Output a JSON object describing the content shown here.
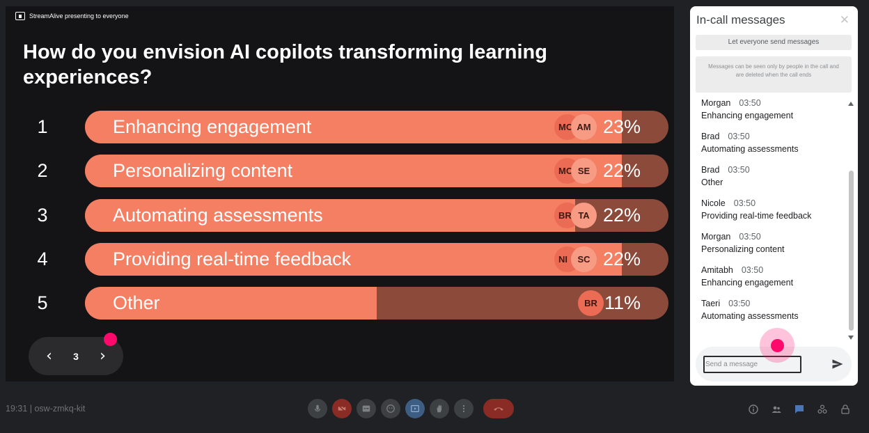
{
  "presentation": {
    "presenting_text": "StreamAlive presenting to everyone",
    "question": "How do you envision AI copilots transforming learning experiences?",
    "options": [
      {
        "number": "1",
        "label": "Enhancing engagement",
        "percent": "23%",
        "fill": 0.92,
        "avatars": [
          "MC",
          "AM"
        ]
      },
      {
        "number": "2",
        "label": "Personalizing content",
        "percent": "22%",
        "fill": 0.92,
        "avatars": [
          "MC",
          "SE"
        ]
      },
      {
        "number": "3",
        "label": "Automating assessments",
        "percent": "22%",
        "fill": 0.84,
        "avatars": [
          "BR",
          "TA"
        ]
      },
      {
        "number": "4",
        "label": "Providing real-time feedback",
        "percent": "22%",
        "fill": 0.92,
        "avatars": [
          "NI",
          "SC"
        ]
      },
      {
        "number": "5",
        "label": "Other",
        "percent": "11%",
        "fill": 0.5,
        "avatars": [
          "BR"
        ]
      }
    ],
    "pager": {
      "page": "3",
      "prev_icon": "chevron-left-icon",
      "next_icon": "chevron-right-icon"
    }
  },
  "panel": {
    "title": "In-call messages",
    "close_icon": "close-icon",
    "toggle_label": "Let everyone send messages",
    "info": "Messages can be seen only by people in the call and are deleted when the call ends",
    "messages": [
      {
        "sender": "Morgan",
        "time": "03:50",
        "text": "Enhancing engagement"
      },
      {
        "sender": "Brad",
        "time": "03:50",
        "text": "Automating assessments"
      },
      {
        "sender": "Brad",
        "time": "03:50",
        "text": "Other"
      },
      {
        "sender": "Nicole",
        "time": "03:50",
        "text": "Providing real-time feedback"
      },
      {
        "sender": "Morgan",
        "time": "03:50",
        "text": "Personalizing content"
      },
      {
        "sender": "Amitabh",
        "time": "03:50",
        "text": "Enhancing engagement"
      },
      {
        "sender": "Taeri",
        "time": "03:50",
        "text": "Automating assessments"
      }
    ],
    "compose_placeholder": "Send a message",
    "send_icon": "send-icon"
  },
  "bottom": {
    "meeting_info": "19:31 | osw-zmkq-kit",
    "controls": [
      "mic-icon",
      "camera-off-icon",
      "captions-icon",
      "emoji-icon",
      "present-icon",
      "raise-hand-icon",
      "more-options-icon",
      "end-call-icon"
    ],
    "right_icons": [
      "info-icon",
      "people-icon",
      "chat-icon",
      "activities-icon",
      "host-controls-icon"
    ]
  },
  "colors": {
    "bar_fill": "#f47f62",
    "bar_track": "#8c4a3b",
    "accent_pink": "#ff0a6c",
    "stage_bg": "#141416"
  }
}
